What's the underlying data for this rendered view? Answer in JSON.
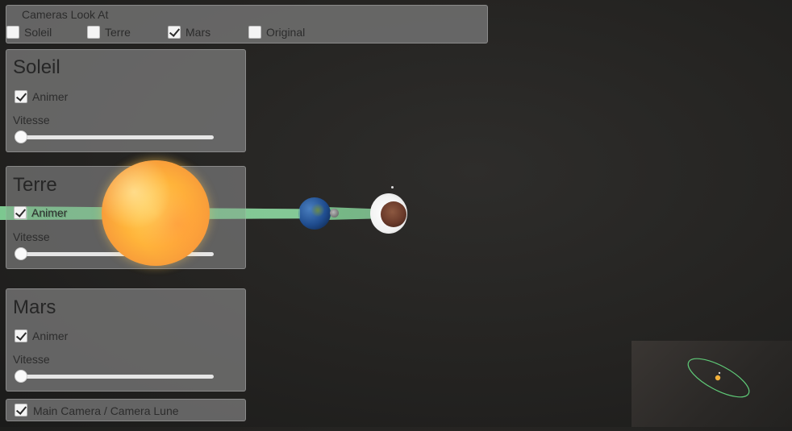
{
  "cameras": {
    "title": "Cameras Look At",
    "options": [
      {
        "label": "Soleil",
        "checked": false
      },
      {
        "label": "Terre",
        "checked": false
      },
      {
        "label": "Mars",
        "checked": true
      },
      {
        "label": "Original",
        "checked": false
      }
    ]
  },
  "panels": [
    {
      "title": "Soleil",
      "animate_label": "Animer",
      "animate_checked": true,
      "speed_label": "Vitesse",
      "speed_value": 0.0
    },
    {
      "title": "Terre",
      "animate_label": "Animer",
      "animate_checked": true,
      "speed_label": "Vitesse",
      "speed_value": 0.0
    },
    {
      "title": "Mars",
      "animate_label": "Animer",
      "animate_checked": true,
      "speed_label": "Vitesse",
      "speed_value": 0.0
    }
  ],
  "main_camera": {
    "label": "Main Camera / Camera Lune",
    "checked": true
  },
  "colors": {
    "orbit_beam": "#8fd6a0",
    "sun": "#ffb33a",
    "earth": "#2b5ea5",
    "mars": "#6a3a2a",
    "panel_bg": "#7a7a7a"
  }
}
